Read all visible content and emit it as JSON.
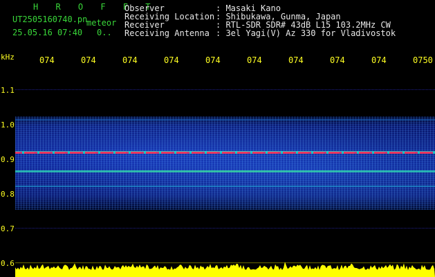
{
  "header": {
    "brand": "H R O F F T",
    "filename": "UT2505160740.pn",
    "kind": "meteor",
    "datetime": "25.05.16 07:40",
    "dots": "0..",
    "info": [
      {
        "label": "Observer",
        "value": ": Masaki Kano"
      },
      {
        "label": "Receiving Location",
        "value": ": Shibukawa, Gunma, Japan"
      },
      {
        "label": "Receiver",
        "value": ": RTL-SDR SDR# 43dB L15 103.2MHz CW"
      },
      {
        "label": "Receiving Antenna",
        "value": ": 3el Yagi(V) Az 330 for Vladivostok"
      }
    ]
  },
  "chart_data": {
    "type": "heatmap",
    "y_unit": "kHz",
    "y_ticks": [
      "1.1",
      "1.0",
      "0.9",
      "0.8",
      "0.7",
      "0.6"
    ],
    "x_ticks": [
      "074",
      "074",
      "074",
      "074",
      "074",
      "074",
      "074",
      "074",
      "074",
      "0750"
    ],
    "signal_lines_khz": [
      0.92,
      0.87
    ]
  },
  "colors": {
    "header_green": "#39d739",
    "axis_yellow": "#ffff22",
    "amplitude_yellow": "#ffff00",
    "signal_red": "#ff2a55",
    "signal_cyan": "#29e0d0"
  }
}
